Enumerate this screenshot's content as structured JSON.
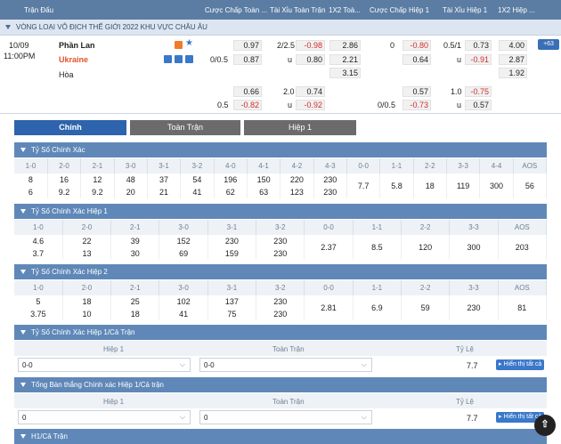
{
  "header": {
    "cols": [
      "Trận Đấu",
      "Cược Chấp Toàn ...",
      "Tài Xỉu Toàn Trận",
      "1X2 Toà...",
      "Cược Chấp Hiệp 1",
      "Tài Xỉu Hiệp 1",
      "1X2 Hiệp ..."
    ]
  },
  "league": "VÒNG LOẠI VÔ ĐỊCH THẾ GIỚI 2022 KHU VỰC CHÂU ÂU",
  "match": {
    "date": "10/09",
    "time": "11:00PM",
    "home": "Phần Lan",
    "away": "Ukraine",
    "draw": "Hòa",
    "plus_label": "+63",
    "hdp_line_home": "",
    "hdp_line_away": "0/0.5",
    "hdp_home": "0.97",
    "hdp_away": "0.87",
    "ou_line": "2/2.5",
    "ou_over": "-0.98",
    "ou_u": "u",
    "ou_under": "0.80",
    "x12_home": "2.86",
    "x12_away": "2.21",
    "x12_draw": "3.15",
    "h1_hdp_line": "0",
    "h1_hdp_home": "-0.80",
    "h1_hdp_away": "0.64",
    "h1_ou_line": "0.5/1",
    "h1_ou_over": "0.73",
    "h1_ou_u": "u",
    "h1_ou_under": "-0.91",
    "h1_x12_home": "4.00",
    "h1_x12_away": "2.87",
    "h1_x12_draw": "1.92",
    "r2_hdp_home": "0.66",
    "r2_hdp_line": "0.5",
    "r2_hdp_away": "-0.82",
    "r2_ou_line": "2.0",
    "r2_ou_over": "0.74",
    "r2_ou_u": "u",
    "r2_ou_under": "-0.92",
    "r2_h1_hdp_home": "0.57",
    "r2_h1_hdp_line": "0/0.5",
    "r2_h1_hdp_away": "-0.73",
    "r2_h1_ou_line": "1.0",
    "r2_h1_ou_over": "-0.75",
    "r2_h1_ou_u": "u",
    "r2_h1_ou_under": "0.57"
  },
  "tabs": [
    "Chính",
    "Toàn Trận",
    "Hiệp 1"
  ],
  "sections": {
    "s1": {
      "title": "Tỷ Số Chính Xác",
      "cols": [
        "1-0",
        "2-0",
        "2-1",
        "3-0",
        "3-1",
        "3-2",
        "4-0",
        "4-1",
        "4-2",
        "4-3",
        "0-0",
        "1-1",
        "2-2",
        "3-3",
        "4-4",
        "AOS"
      ],
      "row1": [
        "8",
        "16",
        "12",
        "48",
        "37",
        "54",
        "196",
        "150",
        "220",
        "230",
        "7.7",
        "5.8",
        "18",
        "119",
        "300",
        "56"
      ],
      "row2": [
        "6",
        "9.2",
        "9.2",
        "20",
        "21",
        "41",
        "62",
        "63",
        "123",
        "230"
      ]
    },
    "s2": {
      "title": "Tỷ Số Chính Xác Hiệp 1",
      "cols": [
        "1-0",
        "2-0",
        "2-1",
        "3-0",
        "3-1",
        "3-2",
        "0-0",
        "1-1",
        "2-2",
        "3-3",
        "AOS"
      ],
      "row1": [
        "4.6",
        "22",
        "39",
        "152",
        "230",
        "230",
        "2.37",
        "8.5",
        "120",
        "300",
        "203"
      ],
      "row2": [
        "3.7",
        "13",
        "30",
        "69",
        "159",
        "230"
      ]
    },
    "s3": {
      "title": "Tỷ Số Chính Xác Hiệp 2",
      "cols": [
        "1-0",
        "2-0",
        "2-1",
        "3-0",
        "3-1",
        "3-2",
        "0-0",
        "1-1",
        "2-2",
        "3-3",
        "AOS"
      ],
      "row1": [
        "5",
        "18",
        "25",
        "102",
        "137",
        "230",
        "2.81",
        "6.9",
        "59",
        "230",
        "81"
      ],
      "row2": [
        "3.75",
        "10",
        "18",
        "41",
        "75",
        "230"
      ]
    },
    "s4": {
      "title": "Tỷ Số Chính Xác Hiệp 1/Cả Trận",
      "h1": "Hiệp 1",
      "ft": "Toàn Trận",
      "rate": "Tỷ Lệ",
      "sel1": "0-0",
      "sel2": "0-0",
      "value": "7.7",
      "btn": "Hiển thị tất cả"
    },
    "s5": {
      "title": "Tổng Bàn thắng Chính xác Hiệp 1/Cả trận",
      "h1": "Hiệp 1",
      "ft": "Toàn Trận",
      "rate": "Tỷ Lệ",
      "sel1": "0",
      "sel2": "0",
      "value": "7.7",
      "btn": "Hiển thị tất cả"
    },
    "s6": {
      "title": "H1/Cả Trận"
    }
  },
  "colors": {
    "header": "#5b7ca3",
    "section": "#5f88b8",
    "tab_active": "#2e63ad",
    "tab_inactive": "#6b6b6b",
    "negative": "#d32c2c"
  },
  "icons": [
    "tv-icon",
    "star-icon",
    "stats-icon",
    "dollar-icon",
    "chart-icon",
    "arrow-up-icon"
  ]
}
